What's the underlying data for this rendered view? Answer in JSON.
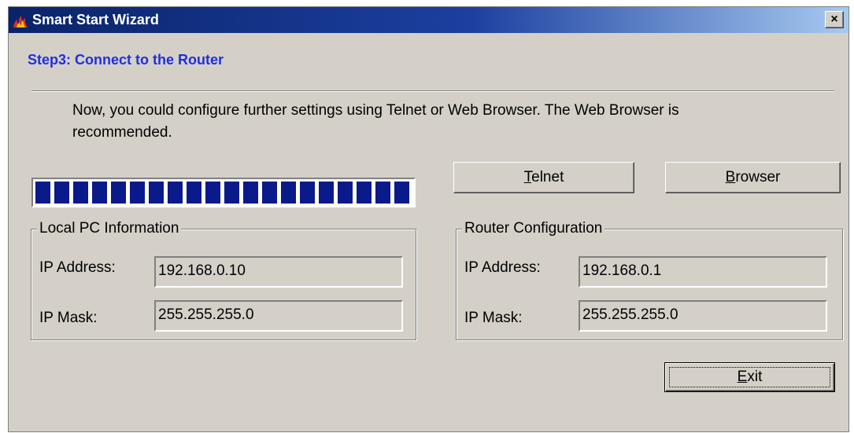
{
  "window": {
    "title": "Smart Start Wizard",
    "app_icon": "flame-icon",
    "close_label": "×"
  },
  "step": {
    "title": "Step3: Connect to the Router",
    "instructions": "Now, you could configure further settings using Telnet or Web Browser. The Web Browser is recommended."
  },
  "progress": {
    "fraction": 1.0
  },
  "buttons": {
    "telnet_label": "Telnet",
    "telnet_mnemonic": "T",
    "telnet_rest": "elnet",
    "browser_label": "Browser",
    "browser_mnemonic": "B",
    "browser_rest": "rowser",
    "exit_label": "Exit",
    "exit_mnemonic": "E",
    "exit_rest": "xit"
  },
  "local_pc": {
    "legend": "Local PC Information",
    "ip_label": "IP Address:",
    "ip_value": "192.168.0.10",
    "mask_label": "IP Mask:",
    "mask_value": "255.255.255.0"
  },
  "router": {
    "legend": "Router Configuration",
    "ip_label": "IP Address:",
    "ip_value": "192.168.0.1",
    "mask_label": "IP Mask:",
    "mask_value": "255.255.255.0"
  }
}
